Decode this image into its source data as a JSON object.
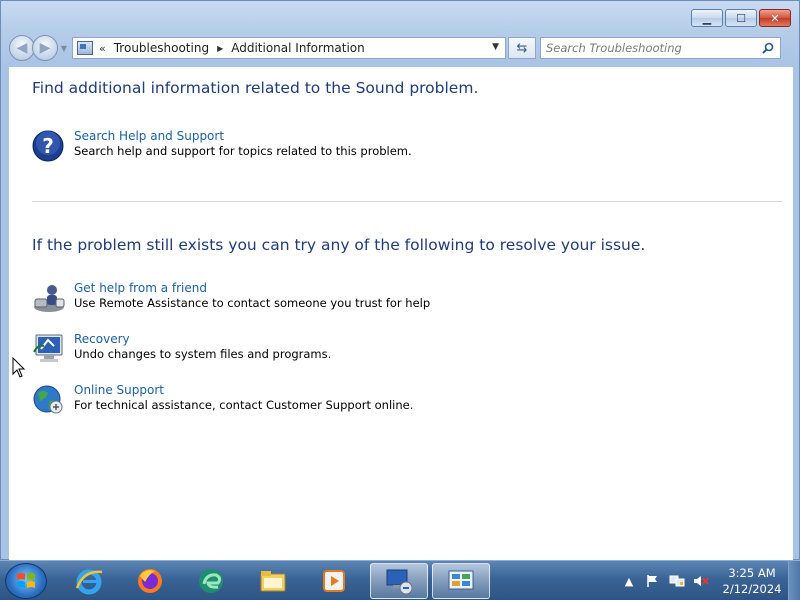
{
  "window": {
    "minimize_glyph": "▁",
    "maximize_glyph": "☐",
    "close_glyph": "✕"
  },
  "navbar": {
    "back_glyph": "◀",
    "forward_glyph": "▶",
    "breadcrumb_overflow": "«",
    "breadcrumbs": [
      "Troubleshooting",
      "Additional Information"
    ],
    "refresh_glyph": "⇆",
    "search_placeholder": "Search Troubleshooting"
  },
  "content": {
    "heading1": "Find additional information related to the Sound problem.",
    "heading2": "If the problem still exists you can try any of the following to resolve your issue.",
    "items": [
      {
        "title": "Search Help and Support",
        "description": "Search help and support for topics related to this problem.",
        "icon": "help-icon"
      },
      {
        "title": "Get help from a friend",
        "description": "Use Remote Assistance to contact someone you trust for help",
        "icon": "remote-assistance-icon"
      },
      {
        "title": "Recovery",
        "description": "Undo changes to system files and programs.",
        "icon": "recovery-icon"
      },
      {
        "title": "Online Support",
        "description": "For technical assistance, contact Customer Support online.",
        "icon": "online-support-icon"
      }
    ]
  },
  "taskbar": {
    "apps": [
      "internet-explorer-icon",
      "firefox-icon",
      "edge-icon",
      "file-explorer-icon",
      "media-player-icon",
      "remote-desktop-icon",
      "control-panel-icon"
    ],
    "tray_chevron": "▲",
    "clock_time": "3:25 AM",
    "clock_date": "2/12/2024"
  },
  "colors": {
    "heading": "#1e3b7c",
    "link": "#1a5fa8",
    "taskbar": "#3a6496"
  }
}
